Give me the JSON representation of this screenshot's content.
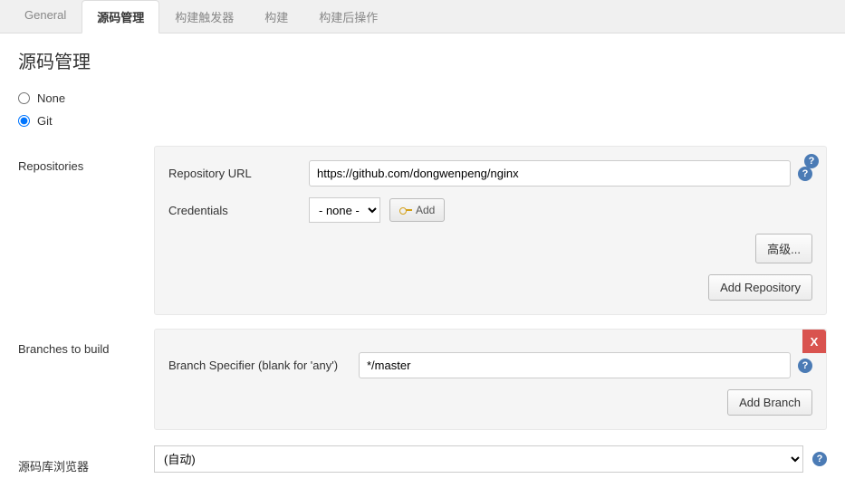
{
  "tabs": {
    "general": "General",
    "scm": "源码管理",
    "triggers": "构建触发器",
    "build": "构建",
    "postbuild": "构建后操作"
  },
  "section": {
    "title": "源码管理"
  },
  "scm_options": {
    "none": "None",
    "git": "Git"
  },
  "repositories": {
    "label": "Repositories",
    "url_label": "Repository URL",
    "url_value": "https://github.com/dongwenpeng/nginx",
    "credentials_label": "Credentials",
    "credentials_selected": "- none -",
    "add_cred_btn": "Add",
    "advanced_btn": "高级...",
    "add_repo_btn": "Add Repository"
  },
  "branches": {
    "label": "Branches to build",
    "specifier_label": "Branch Specifier (blank for 'any')",
    "specifier_value": "*/master",
    "delete_label": "X",
    "add_branch_btn": "Add Branch"
  },
  "repo_browser": {
    "label": "源码库浏览器",
    "selected": "(自动)"
  },
  "help_glyph": "?"
}
